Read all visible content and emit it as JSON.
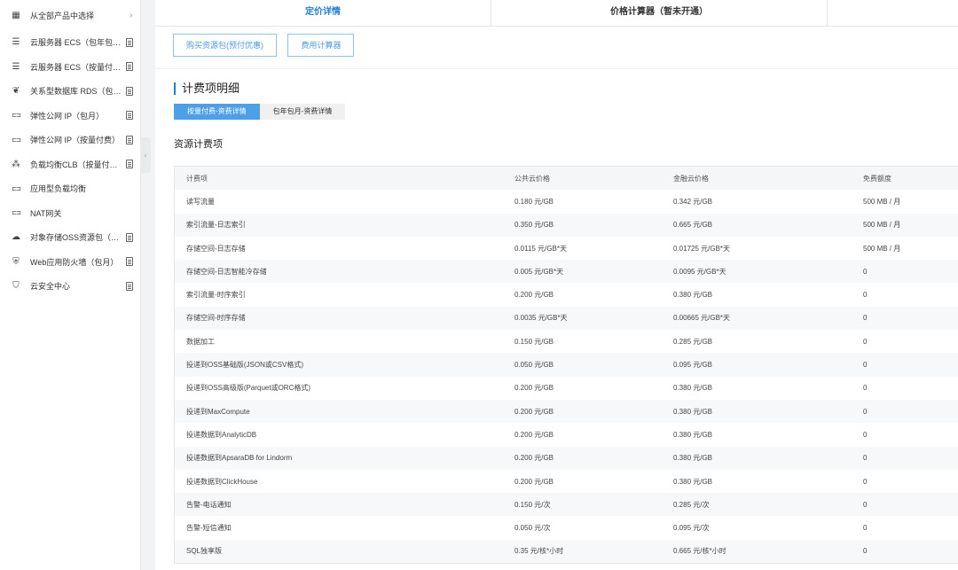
{
  "sidebar": {
    "items": [
      {
        "icon": "grid-icon",
        "label": "从全部产品中选择",
        "trail": "chevron-right-icon",
        "trail_text": "›"
      },
      {
        "icon": "server-icon",
        "label": "云服务器 ECS（包年包月）",
        "trail": "doc-icon"
      },
      {
        "icon": "server-icon",
        "label": "云服务器 ECS（按量付费）",
        "trail": "doc-icon"
      },
      {
        "icon": "database-icon",
        "label": "关系型数据库 RDS（包年包月）",
        "trail": "doc-icon"
      },
      {
        "icon": "eip-icon",
        "label": "弹性公网 IP（包月）",
        "trail": "doc-icon"
      },
      {
        "icon": "eip-icon",
        "label": "弹性公网 IP（按量付费）",
        "trail": "doc-icon"
      },
      {
        "icon": "load-balancer-icon",
        "label": "负载均衡CLB（按量付费）",
        "trail": "doc-icon"
      },
      {
        "icon": "eip-icon",
        "label": "应用型负载均衡",
        "trail": ""
      },
      {
        "icon": "eip-icon",
        "label": "NAT网关",
        "trail": ""
      },
      {
        "icon": "cloud-icon",
        "label": "对象存储OSS资源包（包年）",
        "trail": "doc-icon"
      },
      {
        "icon": "firewall-icon",
        "label": "Web应用防火墙（包月）",
        "trail": "doc-icon"
      },
      {
        "icon": "shield-icon",
        "label": "云安全中心",
        "trail": "doc-icon"
      }
    ],
    "collapse_glyph": "‹"
  },
  "tabs": [
    {
      "label": "定价详情",
      "active": true
    },
    {
      "label": "价格计算器（暂未开通）",
      "active": false
    },
    {
      "label": "",
      "active": false
    }
  ],
  "actions": {
    "buy_package": "购买资源包(预付优惠)",
    "cost_calculator": "费用计算器"
  },
  "section_title": "计费项明细",
  "sub_tabs": [
    {
      "label": "按量付费-资费详情",
      "active": true
    },
    {
      "label": "包年包月-资费详情",
      "active": false
    }
  ],
  "subsection_title": "资源计费项",
  "table": {
    "headers": [
      "计费项",
      "公共云价格",
      "金融云价格",
      "免费额度"
    ],
    "rows": [
      [
        "读写流量",
        "0.180 元/GB",
        "0.342 元/GB",
        "500 MB / 月"
      ],
      [
        "索引流量-日志索引",
        "0.350 元/GB",
        "0.665 元/GB",
        "500 MB / 月"
      ],
      [
        "存储空间-日志存储",
        "0.0115 元/GB*天",
        "0.01725 元/GB*天",
        "500 MB / 月"
      ],
      [
        "存储空间-日志智能冷存储",
        "0.005 元/GB*天",
        "0.0095 元/GB*天",
        "0"
      ],
      [
        "索引流量-时序索引",
        "0.200 元/GB",
        "0.380 元/GB",
        "0"
      ],
      [
        "存储空间-时序存储",
        "0.0035 元/GB*天",
        "0.00665 元/GB*天",
        "0"
      ],
      [
        "数据加工",
        "0.150 元/GB",
        "0.285 元/GB",
        "0"
      ],
      [
        "投递到OSS基础版(JSON或CSV格式)",
        "0.050 元/GB",
        "0.095 元/GB",
        "0"
      ],
      [
        "投递到OSS高级版(Parquet或ORC格式)",
        "0.200 元/GB",
        "0.380 元/GB",
        "0"
      ],
      [
        "投递到MaxCompute",
        "0.200 元/GB",
        "0.380 元/GB",
        "0"
      ],
      [
        "投递数据到AnalyticDB",
        "0.200 元/GB",
        "0.380 元/GB",
        "0"
      ],
      [
        "投递数据到ApsaraDB for Lindorm",
        "0.200 元/GB",
        "0.380 元/GB",
        "0"
      ],
      [
        "投递数据到ClickHouse",
        "0.200 元/GB",
        "0.380 元/GB",
        "0"
      ],
      [
        "告警-电话通知",
        "0.150 元/次",
        "0.285 元/次",
        "0"
      ],
      [
        "告警-短信通知",
        "0.050 元/次",
        "0.095 元/次",
        "0"
      ],
      [
        "SQL独享版",
        "0.35 元/核*小时",
        "0.665 元/核*小时",
        "0"
      ]
    ]
  },
  "colors": {
    "accent": "#1e7fd6",
    "accent_light": "#4d9fe8",
    "row_alt": "#f7f8fa"
  }
}
